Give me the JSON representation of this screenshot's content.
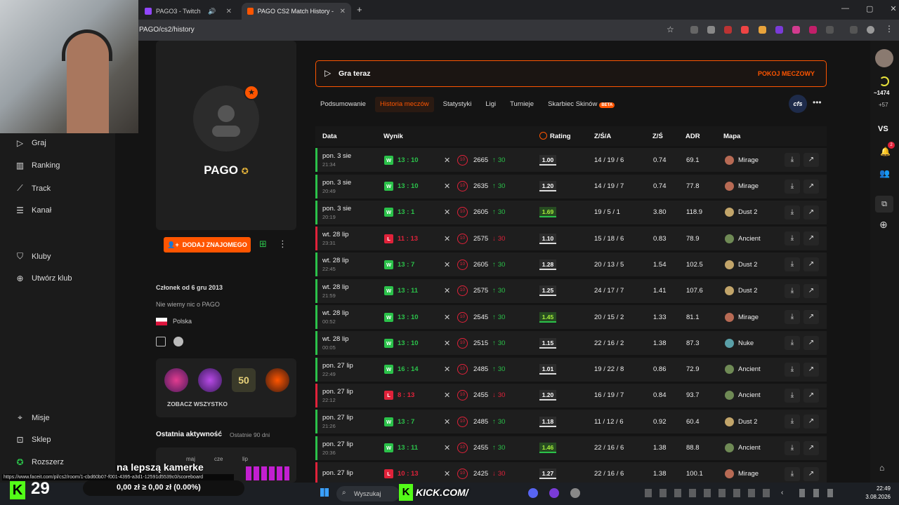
{
  "browser": {
    "tabs": [
      {
        "title": "PAGO3 - Twitch"
      },
      {
        "title": "PAGO CS2 Match History - FAC"
      }
    ],
    "address": "PAGO/cs2/history"
  },
  "left_nav": {
    "items": [
      {
        "label": "Graj",
        "icon": "play-icon"
      },
      {
        "label": "Ranking",
        "icon": "bar-chart-icon"
      },
      {
        "label": "Track",
        "icon": "trend-icon"
      },
      {
        "label": "Kanał",
        "icon": "list-icon"
      }
    ],
    "club_items": [
      {
        "label": "Kluby",
        "icon": "shield-icon"
      },
      {
        "label": "Utwórz klub",
        "icon": "plus-circle-icon"
      }
    ],
    "bottom_items": [
      {
        "label": "Misje",
        "icon": "target-icon"
      },
      {
        "label": "Sklep",
        "icon": "bag-icon"
      },
      {
        "label": "Rozszerz",
        "icon": "star-icon"
      }
    ]
  },
  "profile": {
    "name": "PAGO",
    "add_friend": "DODAJ ZNAJOMEGO",
    "member_since": "Członek od 6 gru 2013",
    "bio": "Nie wiemy nic o PAGO",
    "country": "Polska",
    "see_all": "ZOBACZ WSZYSTKO",
    "recent_activity_title": "Ostatnia aktywność",
    "recent_activity_days": "Ostatnie 90 dni",
    "activity_months": [
      "maj",
      "cze",
      "lip"
    ]
  },
  "main": {
    "play_label": "Gra teraz",
    "match_room": "POKOJ MECZOWY",
    "subtabs": [
      "Podsumowanie",
      "Historia meczów",
      "Statystyki",
      "Ligi",
      "Turnieje",
      "Skarbiec Skinów"
    ],
    "beta": "BETA",
    "table": {
      "headers": {
        "date": "Data",
        "result": "Wynik",
        "rating": "Rating",
        "kda": "Z/Ś/A",
        "kd": "Z/Ś",
        "adr": "ADR",
        "map": "Mapa"
      },
      "rows": [
        {
          "date": "pon. 3 sie",
          "time": "21:34",
          "result": "W",
          "score": "13 : 10",
          "elo": "2665",
          "delta": "30",
          "rating": "1.00",
          "kda": "14 / 19 / 6",
          "kd": "0.74",
          "adr": "69.1",
          "map": "Mirage"
        },
        {
          "date": "pon. 3 sie",
          "time": "20:49",
          "result": "W",
          "score": "13 : 10",
          "elo": "2635",
          "delta": "30",
          "rating": "1.20",
          "kda": "14 / 19 / 7",
          "kd": "0.74",
          "adr": "77.8",
          "map": "Mirage"
        },
        {
          "date": "pon. 3 sie",
          "time": "20:19",
          "result": "W",
          "score": "13 : 1",
          "elo": "2605",
          "delta": "30",
          "rating": "1.69",
          "kda": "19 / 5 / 1",
          "kd": "3.80",
          "adr": "118.9",
          "map": "Dust 2"
        },
        {
          "date": "wt. 28 lip",
          "time": "23:31",
          "result": "L",
          "score": "11 : 13",
          "elo": "2575",
          "delta": "30",
          "rating": "1.10",
          "kda": "15 / 18 / 6",
          "kd": "0.83",
          "adr": "78.9",
          "map": "Ancient"
        },
        {
          "date": "wt. 28 lip",
          "time": "22:45",
          "result": "W",
          "score": "13 : 7",
          "elo": "2605",
          "delta": "30",
          "rating": "1.28",
          "kda": "20 / 13 / 5",
          "kd": "1.54",
          "adr": "102.5",
          "map": "Dust 2"
        },
        {
          "date": "wt. 28 lip",
          "time": "21:59",
          "result": "W",
          "score": "13 : 11",
          "elo": "2575",
          "delta": "30",
          "rating": "1.25",
          "kda": "24 / 17 / 7",
          "kd": "1.41",
          "adr": "107.6",
          "map": "Dust 2"
        },
        {
          "date": "wt. 28 lip",
          "time": "00:52",
          "result": "W",
          "score": "13 : 10",
          "elo": "2545",
          "delta": "30",
          "rating": "1.45",
          "kda": "20 / 15 / 2",
          "kd": "1.33",
          "adr": "81.1",
          "map": "Mirage"
        },
        {
          "date": "wt. 28 lip",
          "time": "00:05",
          "result": "W",
          "score": "13 : 10",
          "elo": "2515",
          "delta": "30",
          "rating": "1.15",
          "kda": "22 / 16 / 2",
          "kd": "1.38",
          "adr": "87.3",
          "map": "Nuke"
        },
        {
          "date": "pon. 27 lip",
          "time": "22:49",
          "result": "W",
          "score": "16 : 14",
          "elo": "2485",
          "delta": "30",
          "rating": "1.01",
          "kda": "19 / 22 / 8",
          "kd": "0.86",
          "adr": "72.9",
          "map": "Ancient"
        },
        {
          "date": "pon. 27 lip",
          "time": "22:12",
          "result": "L",
          "score": "8 : 13",
          "elo": "2455",
          "delta": "30",
          "rating": "1.20",
          "kda": "16 / 19 / 7",
          "kd": "0.84",
          "adr": "93.7",
          "map": "Ancient"
        },
        {
          "date": "pon. 27 lip",
          "time": "21:26",
          "result": "W",
          "score": "13 : 7",
          "elo": "2485",
          "delta": "30",
          "rating": "1.18",
          "kda": "11 / 12 / 6",
          "kd": "0.92",
          "adr": "60.4",
          "map": "Dust 2"
        },
        {
          "date": "pon. 27 lip",
          "time": "20:36",
          "result": "W",
          "score": "13 : 11",
          "elo": "2455",
          "delta": "30",
          "rating": "1.46",
          "kda": "22 / 16 / 6",
          "kd": "1.38",
          "adr": "88.8",
          "map": "Ancient"
        },
        {
          "date": "pon. 27 lip",
          "time": "",
          "result": "L",
          "score": "10 : 13",
          "elo": "2425",
          "delta": "30",
          "rating": "1.27",
          "kda": "22 / 16 / 6",
          "kd": "1.38",
          "adr": "100.1",
          "map": "Mirage"
        }
      ]
    }
  },
  "right_rail": {
    "elo": "~1474",
    "elo_delta": "+57",
    "vs": "VS",
    "notif_count": "2"
  },
  "overlay": {
    "status_url": "https://www.faceit.com/pl/cs2/room/1-cbd60b07-f001-4395-a3d1-12591d5539c0/scoreboard",
    "caption": "na lepszą kamerke",
    "counter": "29",
    "money": "0,00 zł ≥ 0,00 zł (0.00%)",
    "kick": "KICK.COM/"
  },
  "taskbar": {
    "search": "Wyszukaj",
    "time": "22:49",
    "date": "3.08.2026"
  },
  "colors": {
    "accent": "#ff5500",
    "win": "#2bc24a",
    "loss": "#e0223a"
  }
}
